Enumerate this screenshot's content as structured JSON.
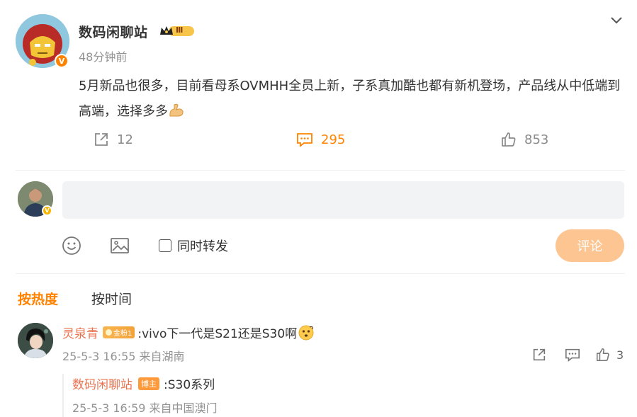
{
  "post": {
    "author": "数码闲聊站",
    "rank_badge": "Ⅲ",
    "time_ago": "48分钟前",
    "text": "5月新品也很多，目前看母系OVMHH全员上新，子系真加酷也都有新机登场，产品线从中低端到高端，选择多多",
    "verified_mark": "V",
    "actions": {
      "repost_count": "12",
      "comment_count": "295",
      "like_count": "853"
    },
    "icons": {
      "collapse": "chevron-down-icon",
      "repost": "share-icon",
      "comment": "comment-icon",
      "like": "thumbs-up-icon",
      "text_emoji": "flexed-biceps-emoji"
    }
  },
  "composer": {
    "input_value": "",
    "repost_label": "同时转发",
    "submit_label": "评论",
    "icons": {
      "emoji": "smiley-icon",
      "image": "image-icon"
    }
  },
  "sort": {
    "hot_label": "按热度",
    "time_label": "按时间"
  },
  "comments": [
    {
      "user": "灵泉青",
      "badge": "金粉1",
      "text": ":vivo下一代是S21还是S30啊",
      "emoji": "thinking-emoji",
      "meta": "25-5-3 16:55 来自湖南",
      "like_count": "3",
      "replies": [
        {
          "user": "数码闲聊站",
          "badge": "博主",
          "text": ":S30系列",
          "meta": "25-5-3 16:59 来自中国澳门"
        }
      ]
    }
  ],
  "colors": {
    "accent": "#ff8200",
    "username": "#eb7350",
    "muted": "#939393",
    "submit_disabled": "#fdc592"
  }
}
